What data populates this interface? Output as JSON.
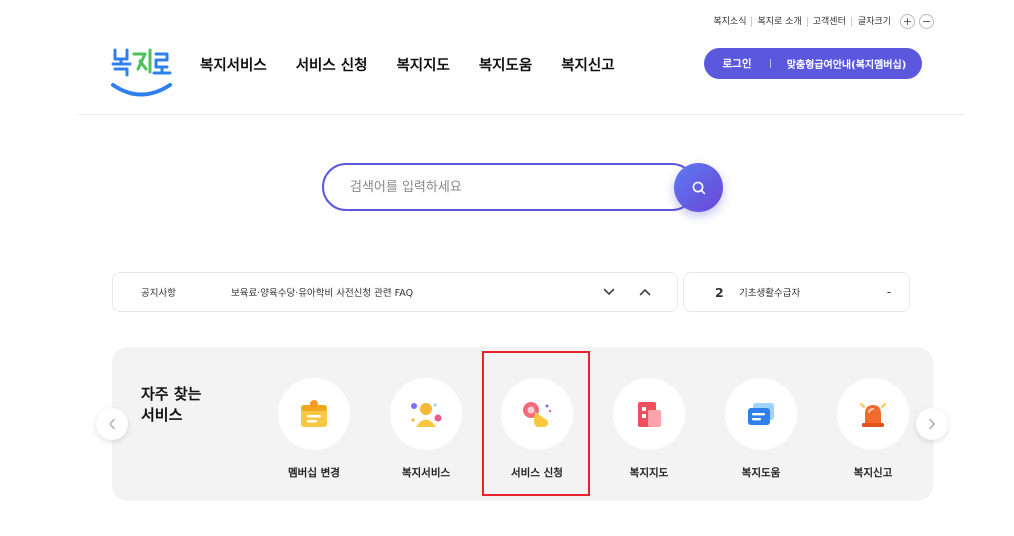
{
  "utility": {
    "links": [
      "복지소식",
      "복지로 소개",
      "고객센터"
    ],
    "font_size_label": "글자크기",
    "increase": "+",
    "decrease": "−"
  },
  "logo": {
    "alt": "복지로"
  },
  "gnb": [
    "복지서비스",
    "서비스 신청",
    "복지지도",
    "복지도움",
    "복지신고"
  ],
  "header": {
    "login": "로그인",
    "membership_guide": "맞춤형급여안내(복지멤버십)"
  },
  "search": {
    "placeholder": "검색어를 입력하세요",
    "button_icon": "search-icon"
  },
  "notice": {
    "label": "공지사항",
    "title": "보육료·양육수당·유아학비 사전신청 관련 FAQ"
  },
  "ranking": {
    "rank": "2",
    "keyword": "기초생활수급자",
    "change": "-"
  },
  "frequent": {
    "title_line1": "자주 찾는",
    "title_line2": "서비스",
    "items": [
      {
        "label": "멤버십 변경",
        "icon": "membership-card-icon"
      },
      {
        "label": "복지서비스",
        "icon": "people-icon"
      },
      {
        "label": "서비스 신청",
        "icon": "hand-tap-icon"
      },
      {
        "label": "복지지도",
        "icon": "building-map-icon"
      },
      {
        "label": "복지도움",
        "icon": "chat-message-icon"
      },
      {
        "label": "복지신고",
        "icon": "siren-icon"
      }
    ],
    "highlighted": "서비스 신청"
  },
  "colors": {
    "primary": "#5b58de",
    "highlight_border": "#e8232a",
    "panel_bg": "#f3f3f3",
    "logo_green": "#4cc35a",
    "logo_blue": "#2f80ed"
  }
}
